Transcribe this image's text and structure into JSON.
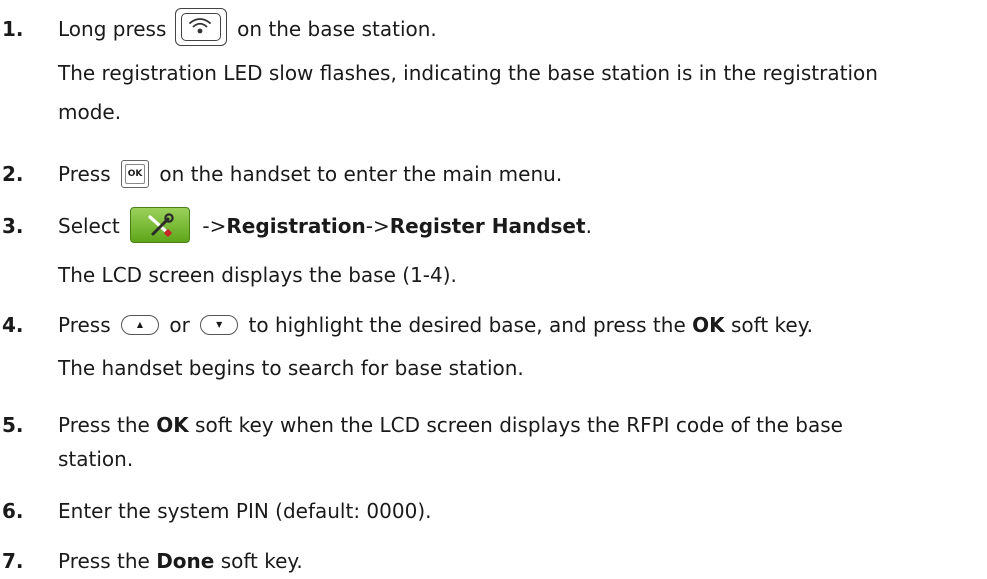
{
  "steps": [
    {
      "num": "1.",
      "text_pre": "Long press",
      "text_post": "on the base station.",
      "note": "The registration LED slow flashes, indicating the base station is in the registration",
      "note_cont": "mode.",
      "icon": "registration-button-icon"
    },
    {
      "num": "2.",
      "text_pre": "Press",
      "text_post": "on the handset to enter the main menu.",
      "icon": "ok-key-icon",
      "icon_label": "OK"
    },
    {
      "num": "3.",
      "text_pre": "Select",
      "sep1": "->",
      "bold1": "Registration",
      "sep2": "->",
      "bold2": "Register Handset",
      "end": ".",
      "note": "The LCD screen displays the base (1-4).",
      "icon": "settings-icon"
    },
    {
      "num": "4.",
      "text_pre": "Press",
      "or": "or",
      "text_mid": "to highlight the desired base, and press the",
      "bold": "OK",
      "text_post": "soft key.",
      "note": "The handset begins to search for base station.",
      "icon_up": "up-arrow-key-icon",
      "icon_down": "down-arrow-key-icon"
    },
    {
      "num": "5.",
      "text_pre": "Press the",
      "bold": "OK",
      "text_post": "soft key when the LCD screen displays the RFPI code of the base",
      "cont": "station."
    },
    {
      "num": "6.",
      "text": "Enter the system PIN (default: 0000)."
    },
    {
      "num": "7.",
      "text_pre": "Press the",
      "bold": "Done",
      "text_post": "soft key."
    }
  ],
  "colors": {
    "text": "#1a1a1a",
    "settings_tile": "#6fb52a",
    "settings_icon": "#ffffff"
  }
}
